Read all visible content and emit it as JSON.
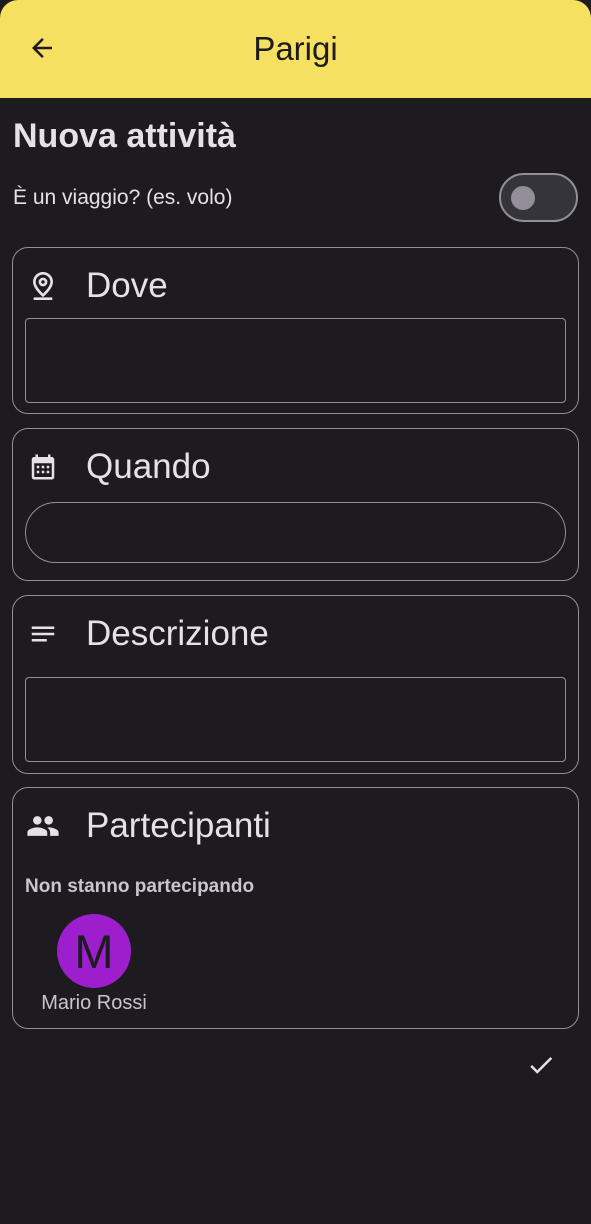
{
  "appbar": {
    "title": "Parigi",
    "back_icon": "arrow-back-icon",
    "background": "#f6e060"
  },
  "form": {
    "title": "Nuova attività",
    "trip_toggle": {
      "label": "È un viaggio? (es. volo)",
      "checked": false
    },
    "where": {
      "title": "Dove",
      "icon": "location-pin-icon",
      "value": ""
    },
    "when": {
      "title": "Quando",
      "icon": "calendar-icon",
      "value": ""
    },
    "description": {
      "title": "Descrizione",
      "icon": "notes-icon",
      "value": ""
    },
    "participants": {
      "title": "Partecipanti",
      "icon": "people-icon",
      "not_participating_label": "Non stanno partecipando",
      "people": [
        {
          "initial": "M",
          "name": "Mario Rossi",
          "color": "#9c1ecc"
        }
      ]
    },
    "confirm_icon": "check-icon"
  },
  "colors": {
    "background": "#1d1b20",
    "outline": "#938f99",
    "text": "#e6e1e5"
  }
}
